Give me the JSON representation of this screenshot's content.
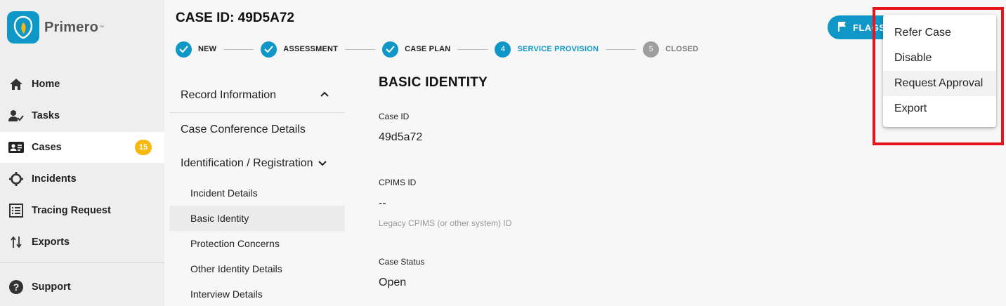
{
  "app": {
    "name": "Primero"
  },
  "sidebar": {
    "items": [
      {
        "label": "Home",
        "icon": "home-icon"
      },
      {
        "label": "Tasks",
        "icon": "tasks-icon"
      },
      {
        "label": "Cases",
        "icon": "cases-icon",
        "badge": "15",
        "active": true
      },
      {
        "label": "Incidents",
        "icon": "incidents-icon"
      },
      {
        "label": "Tracing Request",
        "icon": "tracing-request-icon"
      },
      {
        "label": "Exports",
        "icon": "exports-icon"
      },
      {
        "label": "Support",
        "icon": "support-icon"
      }
    ]
  },
  "header": {
    "case_title": "CASE ID: 49D5A72",
    "flags_label": "FLAGS"
  },
  "stepper": {
    "steps": [
      {
        "label": "NEW",
        "state": "done"
      },
      {
        "label": "ASSESSMENT",
        "state": "done"
      },
      {
        "label": "CASE PLAN",
        "state": "done"
      },
      {
        "label": "SERVICE PROVISION",
        "number": "4",
        "state": "current"
      },
      {
        "label": "CLOSED",
        "number": "5",
        "state": "future"
      }
    ]
  },
  "form_nav": {
    "groups": [
      {
        "label": "Record Information",
        "expanded": true,
        "chevron": "chevron-up-icon"
      },
      {
        "label": "Case Conference Details"
      },
      {
        "label": "Identification / Registration",
        "expanded": true,
        "chevron": "chevron-down-icon"
      }
    ],
    "sub_items": [
      {
        "label": "Incident Details"
      },
      {
        "label": "Basic Identity",
        "selected": true
      },
      {
        "label": "Protection Concerns"
      },
      {
        "label": "Other Identity Details"
      },
      {
        "label": "Interview Details"
      }
    ]
  },
  "content": {
    "title": "BASIC IDENTITY",
    "fields": [
      {
        "label": "Case ID",
        "value": "49d5a72"
      },
      {
        "label": "CPIMS ID",
        "value": "--",
        "help": "Legacy CPIMS (or other system) ID"
      },
      {
        "label": "Case Status",
        "value": "Open"
      }
    ]
  },
  "actions_menu": {
    "items": [
      {
        "label": "Refer Case"
      },
      {
        "label": "Disable"
      },
      {
        "label": "Request Approval",
        "hovered": true
      },
      {
        "label": "Export"
      }
    ]
  },
  "colors": {
    "accent": "#0f97c7",
    "badge": "#f9b80f",
    "highlight": "#e8141c"
  }
}
